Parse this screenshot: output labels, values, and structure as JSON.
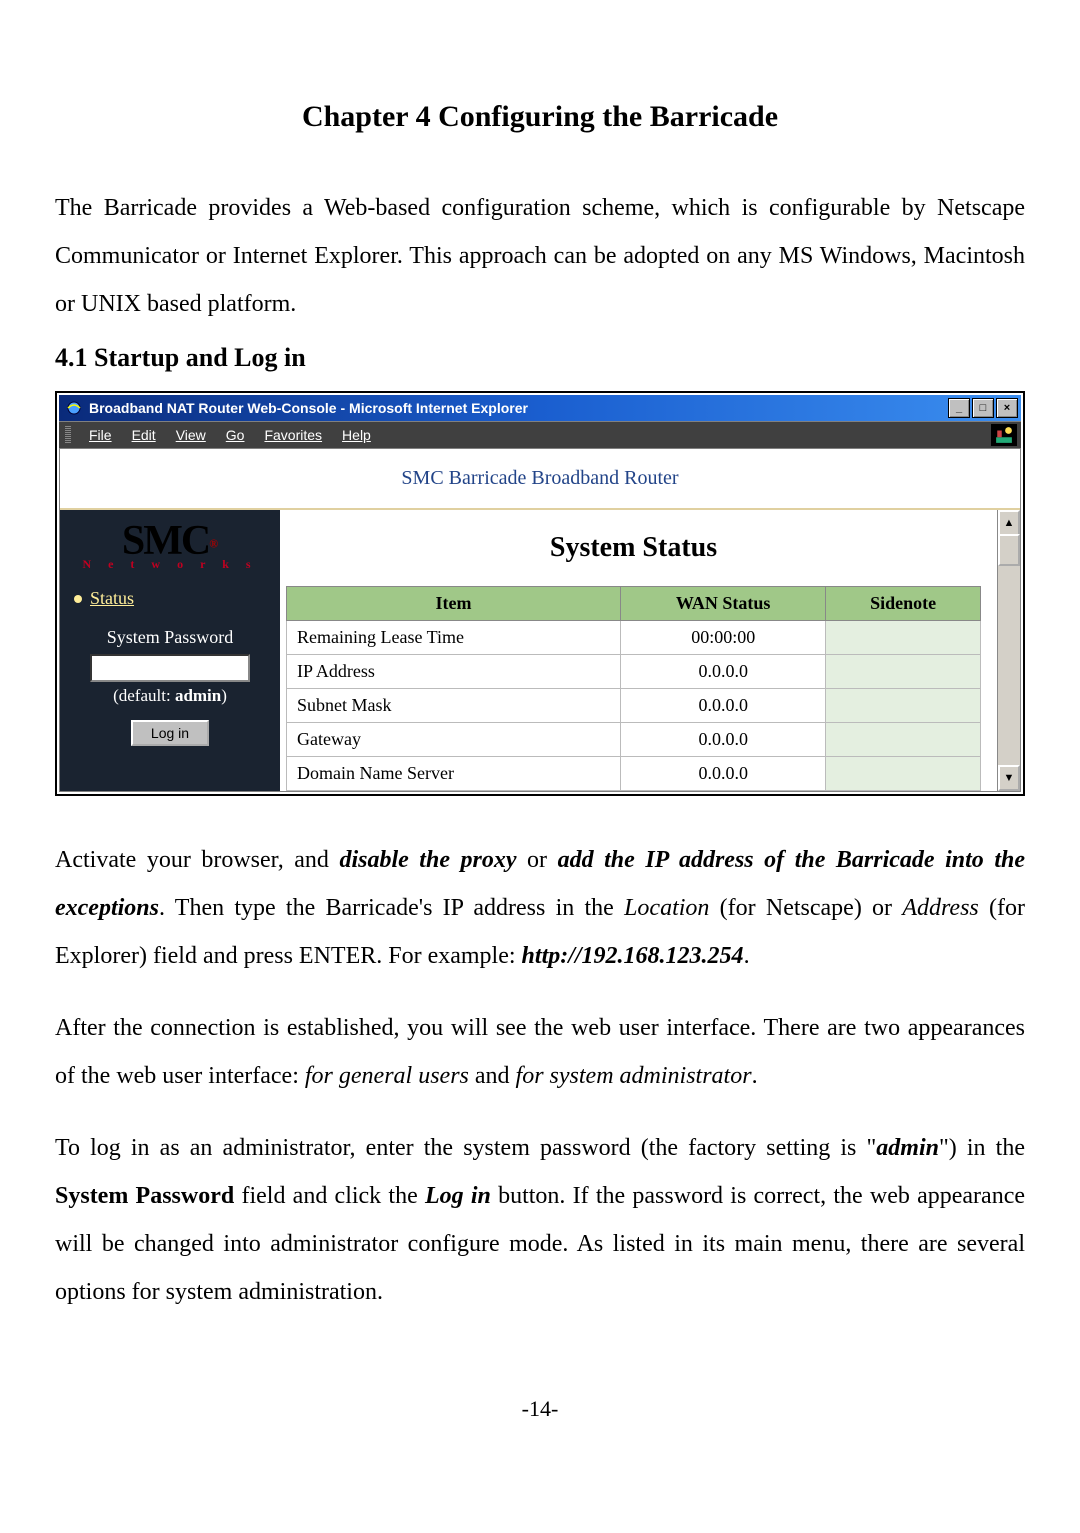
{
  "chapter_title": "Chapter 4  Configuring the Barricade",
  "intro_paragraph_parts": {
    "p1": "The Barricade provides a Web-based configuration scheme, which is configurable by Netscape Communicator or Internet Explorer. This approach can be adopted on any MS Windows, Macintosh or UNIX based platform."
  },
  "section_title": "4.1 Startup and Log in",
  "window": {
    "title": "Broadband NAT Router Web-Console - Microsoft Internet Explorer",
    "menus": [
      "File",
      "Edit",
      "View",
      "Go",
      "Favorites",
      "Help"
    ],
    "controls": {
      "min": "_",
      "max": "□",
      "close": "×"
    }
  },
  "banner_text": "SMC Barricade Broadband Router",
  "logo": {
    "brand": "SMC",
    "subtitle": "N e t w o r k s"
  },
  "sidebar": {
    "status_link": "Status",
    "password_label": "System Password",
    "password_hint_prefix": "(default: ",
    "password_hint_value": "admin",
    "password_hint_suffix": ")",
    "login_button": "Log in"
  },
  "main": {
    "title": "System Status",
    "headers": {
      "item": "Item",
      "wan": "WAN Status",
      "side": "Sidenote"
    },
    "rows": [
      {
        "item": "Remaining Lease Time",
        "wan": "00:00:00",
        "side": ""
      },
      {
        "item": "IP Address",
        "wan": "0.0.0.0",
        "side": ""
      },
      {
        "item": "Subnet Mask",
        "wan": "0.0.0.0",
        "side": ""
      },
      {
        "item": "Gateway",
        "wan": "0.0.0.0",
        "side": ""
      },
      {
        "item": "Domain Name Server",
        "wan": "0.0.0.0",
        "side": ""
      }
    ]
  },
  "para2": {
    "a": "Activate your browser, and ",
    "b": "disable the proxy",
    "c": " or ",
    "d": "add the IP address of the Barricade into the exceptions",
    "e": ". Then type the Barricade's IP address in the ",
    "f": "Location",
    "g": " (for Netscape) or ",
    "h": "Address",
    "i": " (for Explorer) field and press ENTER. For example: ",
    "j": "http://192.168.123.254",
    "k": "."
  },
  "para3": {
    "a": "After the connection is established, you will see the web user interface. There are two appearances of the web user interface: ",
    "b": "for general users",
    "c": " and ",
    "d": "for system administrator",
    "e": "."
  },
  "para4": {
    "a": "To log in as an administrator, enter the system password (the factory setting is \"",
    "b": "admin",
    "c": "\") in the ",
    "d": "System Password",
    "e": " field and click the ",
    "f": "Log in",
    "g": " button. If the password is correct, the web appearance will be changed into administrator configure mode. As listed in its main menu, there are several options for system administration."
  },
  "page_number": "-14-"
}
